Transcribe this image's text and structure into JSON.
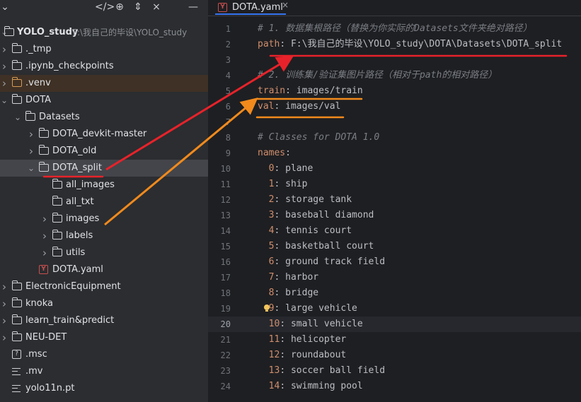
{
  "project": {
    "name": "YOLO_study",
    "path": "F:\\我自己的毕设\\YOLO_study",
    "tree": [
      {
        "label": "._tmp",
        "type": "folder",
        "depth": 0,
        "collapsed": true
      },
      {
        "label": ".ipynb_checkpoints",
        "type": "folder",
        "depth": 0,
        "collapsed": true
      },
      {
        "label": ".venv",
        "type": "folder-excluded",
        "depth": 0,
        "collapsed": true
      },
      {
        "label": "DOTA",
        "type": "folder",
        "depth": 0,
        "collapsed": false
      },
      {
        "label": "Datasets",
        "type": "folder",
        "depth": 1,
        "collapsed": false
      },
      {
        "label": "DOTA_devkit-master",
        "type": "folder",
        "depth": 2,
        "collapsed": true
      },
      {
        "label": "DOTA_old",
        "type": "folder",
        "depth": 2,
        "collapsed": true
      },
      {
        "label": "DOTA_split",
        "type": "folder",
        "depth": 2,
        "collapsed": false,
        "selected": true
      },
      {
        "label": "all_images",
        "type": "folder",
        "depth": 3,
        "collapsed": null
      },
      {
        "label": "all_txt",
        "type": "folder",
        "depth": 3,
        "collapsed": null
      },
      {
        "label": "images",
        "type": "folder",
        "depth": 3,
        "collapsed": true
      },
      {
        "label": "labels",
        "type": "folder",
        "depth": 3,
        "collapsed": true
      },
      {
        "label": "utils",
        "type": "folder",
        "depth": 3,
        "collapsed": true
      },
      {
        "label": "DOTA.yaml",
        "type": "yaml",
        "depth": 2,
        "collapsed": null
      },
      {
        "label": "ElectronicEquipment",
        "type": "folder",
        "depth": 0,
        "collapsed": true
      },
      {
        "label": "knoka",
        "type": "folder",
        "depth": 0,
        "collapsed": true
      },
      {
        "label": "learn_train&predict",
        "type": "folder",
        "depth": 0,
        "collapsed": true
      },
      {
        "label": "NEU-DET",
        "type": "folder",
        "depth": 0,
        "collapsed": true
      },
      {
        "label": ".msc",
        "type": "unknown",
        "depth": 0,
        "collapsed": null
      },
      {
        "label": ".mv",
        "type": "text",
        "depth": 0,
        "collapsed": null
      },
      {
        "label": "yolo11n.pt",
        "type": "text",
        "depth": 0,
        "collapsed": null
      }
    ]
  },
  "editor": {
    "tab_label": "DOTA.yaml",
    "tab_icon": "Y",
    "current_line": 20,
    "lines": [
      {
        "n": "1",
        "parts": [
          {
            "t": "# 1. 数据集根路径（替换为你实际的Datasets文件夹绝对路径）",
            "c": "cm"
          }
        ]
      },
      {
        "n": "2",
        "parts": [
          {
            "t": "path",
            "c": "key"
          },
          {
            "t": ": F:\\我自己的毕设\\YOLO_study\\DOTA\\Datasets\\DOTA_split",
            "c": "val"
          }
        ]
      },
      {
        "n": "3",
        "parts": []
      },
      {
        "n": "4",
        "parts": [
          {
            "t": "# 2. 训练集/验证集图片路径（相对于path的相对路径）",
            "c": "cm"
          }
        ]
      },
      {
        "n": "5",
        "parts": [
          {
            "t": "train",
            "c": "key"
          },
          {
            "t": ": images/train",
            "c": "val"
          }
        ]
      },
      {
        "n": "6",
        "parts": [
          {
            "t": "val",
            "c": "key"
          },
          {
            "t": ": images/val",
            "c": "val"
          }
        ]
      },
      {
        "n": "7",
        "parts": []
      },
      {
        "n": "8",
        "parts": [
          {
            "t": "# Classes for DOTA 1.0",
            "c": "cm"
          }
        ]
      },
      {
        "n": "9",
        "parts": [
          {
            "t": "names",
            "c": "key"
          },
          {
            "t": ":",
            "c": "val"
          }
        ]
      },
      {
        "n": "10",
        "parts": [
          {
            "t": "  0",
            "c": "key"
          },
          {
            "t": ": plane",
            "c": "val"
          }
        ]
      },
      {
        "n": "11",
        "parts": [
          {
            "t": "  1",
            "c": "key"
          },
          {
            "t": ": ship",
            "c": "val"
          }
        ]
      },
      {
        "n": "12",
        "parts": [
          {
            "t": "  2",
            "c": "key"
          },
          {
            "t": ": storage tank",
            "c": "val"
          }
        ]
      },
      {
        "n": "13",
        "parts": [
          {
            "t": "  3",
            "c": "key"
          },
          {
            "t": ": baseball diamond",
            "c": "val"
          }
        ]
      },
      {
        "n": "14",
        "parts": [
          {
            "t": "  4",
            "c": "key"
          },
          {
            "t": ": tennis court",
            "c": "val"
          }
        ]
      },
      {
        "n": "15",
        "parts": [
          {
            "t": "  5",
            "c": "key"
          },
          {
            "t": ": basketball court",
            "c": "val"
          }
        ]
      },
      {
        "n": "16",
        "parts": [
          {
            "t": "  6",
            "c": "key"
          },
          {
            "t": ": ground track field",
            "c": "val"
          }
        ]
      },
      {
        "n": "17",
        "parts": [
          {
            "t": "  7",
            "c": "key"
          },
          {
            "t": ": harbor",
            "c": "val"
          }
        ]
      },
      {
        "n": "18",
        "parts": [
          {
            "t": "  8",
            "c": "key"
          },
          {
            "t": ": bridge",
            "c": "val"
          }
        ]
      },
      {
        "n": "19",
        "parts": [
          {
            "t": "  9",
            "c": "key"
          },
          {
            "t": ": large vehicle",
            "c": "val"
          }
        ],
        "bulb": true
      },
      {
        "n": "20",
        "parts": [
          {
            "t": "  10",
            "c": "key"
          },
          {
            "t": ": small vehicle",
            "c": "val"
          }
        ]
      },
      {
        "n": "21",
        "parts": [
          {
            "t": "  11",
            "c": "key"
          },
          {
            "t": ": helicopter",
            "c": "val"
          }
        ]
      },
      {
        "n": "22",
        "parts": [
          {
            "t": "  12",
            "c": "key"
          },
          {
            "t": ": roundabout",
            "c": "val"
          }
        ]
      },
      {
        "n": "23",
        "parts": [
          {
            "t": "  13",
            "c": "key"
          },
          {
            "t": ": soccer ball field",
            "c": "val"
          }
        ]
      },
      {
        "n": "24",
        "parts": [
          {
            "t": "  14",
            "c": "key"
          },
          {
            "t": ": swimming pool",
            "c": "val"
          }
        ]
      }
    ]
  },
  "icons": {
    "header": [
      "chevron-down-icon",
      "collapse-all-icon",
      "locate-icon",
      "expand-collapse-icon",
      "close-icon",
      "menu-icon"
    ]
  },
  "colors": {
    "underline_red": "#e8222a",
    "underline_orange": "#f28a1c",
    "arrow_red": "#e8222a",
    "arrow_orange": "#f28a1c",
    "key": "#cf8e6d",
    "comment": "#7a7e85"
  }
}
